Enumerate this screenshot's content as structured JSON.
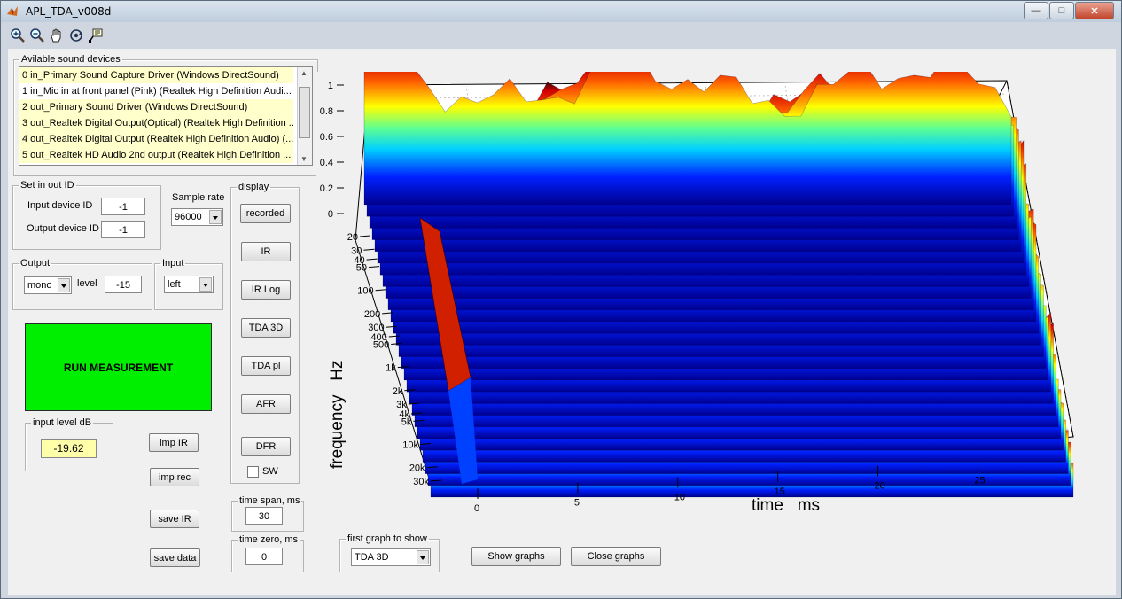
{
  "window": {
    "title": "APL_TDA_v008d"
  },
  "devices": {
    "legend": "Avilable sound devices",
    "items": [
      "0 in_Primary Sound Capture Driver (Windows DirectSound)",
      "1 in_Mic in at front panel (Pink) (Realtek High Definition Audi...",
      "2 out_Primary Sound Driver (Windows DirectSound)",
      "3 out_Realtek Digital Output(Optical) (Realtek High Definition ...",
      "4 out_Realtek Digital Output (Realtek High Definition Audio) (...",
      "5 out_Realtek HD Audio 2nd output (Realtek High Definition ..."
    ]
  },
  "io_id": {
    "legend": "Set in out ID",
    "input_label": "Input device ID",
    "input_value": "-1",
    "output_label": "Output device ID",
    "output_value": "-1"
  },
  "sample_rate": {
    "label": "Sample rate",
    "value": "96000"
  },
  "output": {
    "legend": "Output",
    "mode": "mono",
    "level_label": "level",
    "level_value": "-15"
  },
  "input": {
    "legend": "Input",
    "value": "left"
  },
  "run_label": "RUN MEASUREMENT",
  "input_level": {
    "legend": "input level dB",
    "value": "-19.62"
  },
  "side_buttons": {
    "imp_ir": "imp IR",
    "imp_rec": "imp rec",
    "save_ir": "save IR",
    "save_data": "save data"
  },
  "display": {
    "legend": "display",
    "buttons": [
      "recorded",
      "IR",
      "IR Log",
      "TDA 3D",
      "TDA pl",
      "AFR",
      "DFR"
    ],
    "sw_label": "SW"
  },
  "time_span": {
    "legend": "time span, ms",
    "value": "30"
  },
  "time_zero": {
    "legend": "time zero, ms",
    "value": "0"
  },
  "first_graph": {
    "legend": "first graph to show",
    "value": "TDA 3D"
  },
  "bottom_buttons": {
    "show": "Show graphs",
    "close": "Close graphs"
  },
  "chart_data": {
    "type": "surface-3d",
    "xlabel": "time   ms",
    "ylabel": "frequency   Hz",
    "x_ticks": [
      "0",
      "5",
      "10",
      "15",
      "20",
      "25"
    ],
    "y_ticks": [
      "20",
      "30",
      "40",
      "50",
      "100",
      "200",
      "300",
      "400",
      "500",
      "1k",
      "2k",
      "3k",
      "4k",
      "5k",
      "10k",
      "20k",
      "30k"
    ],
    "z_ticks": [
      "0",
      "0.2",
      "0.4",
      "0.6",
      "0.8",
      "1"
    ],
    "zlim": [
      0,
      1
    ],
    "colormap": "jet",
    "grid": true
  }
}
